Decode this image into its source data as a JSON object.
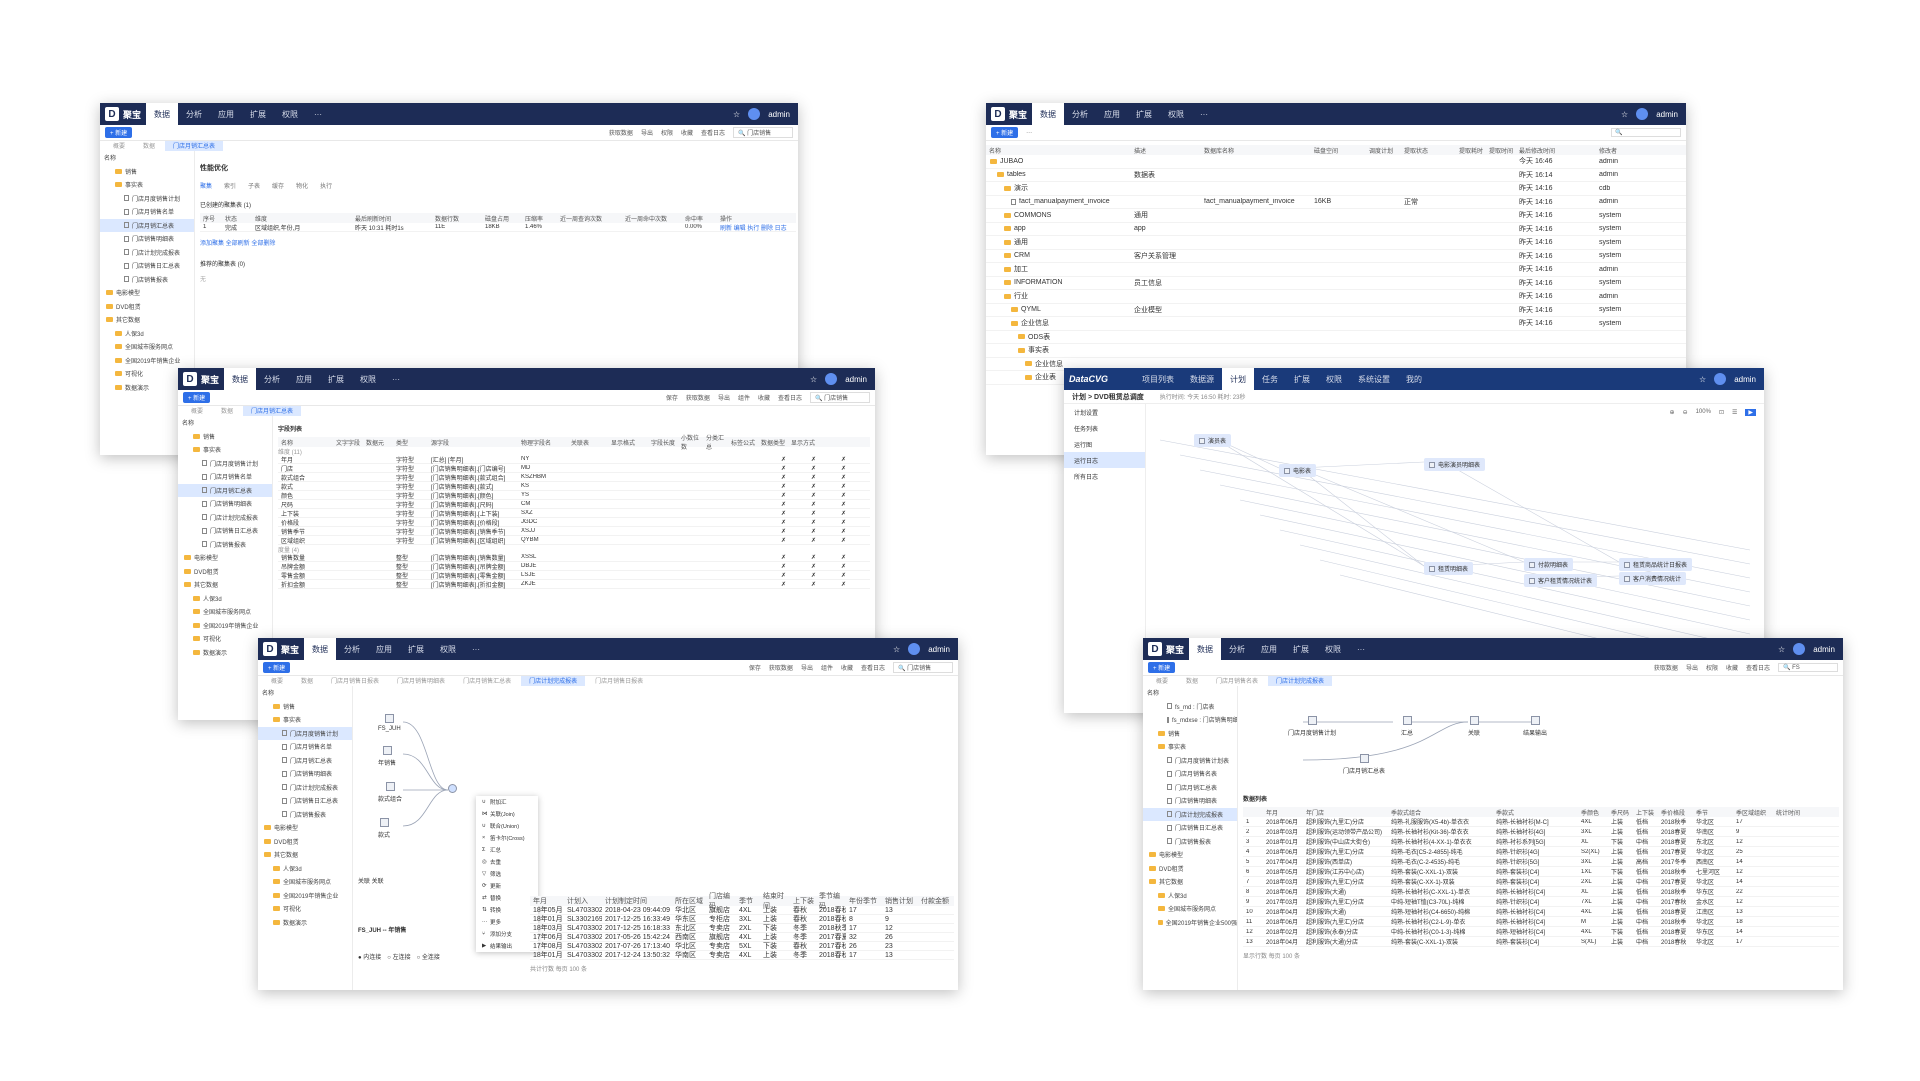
{
  "topnav": {
    "app_name": "聚宝",
    "items": [
      "数据",
      "分析",
      "应用",
      "扩展",
      "权限"
    ],
    "more": "···",
    "user": "admin"
  },
  "toolbar": {
    "new_label": "+ 新建",
    "w1": [
      "获取数据",
      "导出",
      "权限",
      "收藏",
      "查看日志"
    ],
    "w3": [
      "保存",
      "获取数据",
      "导出",
      "组件",
      "收藏",
      "查看日志"
    ],
    "search_placeholder": "门店销售",
    "w4_search": "FS"
  },
  "tabs": {
    "w1": [
      "概要",
      "数据",
      "门店月销汇总表"
    ],
    "w3": [
      "概要",
      "数据",
      "门店月销汇总表"
    ],
    "w5": [
      "概要",
      "数据",
      "门店月销售日报表",
      "门店月销售明细表",
      "门店月销售汇总表",
      "门店计划完成报表",
      "门店月销售日报表"
    ],
    "w6": [
      "概要",
      "数据",
      "门店月销售名表",
      "门店计划完成报表"
    ]
  },
  "sidebar": {
    "title": "名称",
    "w1": [
      "销售",
      "事实表",
      "门店月度销售计划",
      "门店月销售名单",
      "门店月销汇总表",
      "门店销售明细表",
      "门店计划完成报表",
      "门店销售日汇总表",
      "门店销售报表",
      "电影模型",
      "DVD租赁",
      "其它数据",
      "人保3d",
      "全国城市服务网点",
      "全国2019年销售企业",
      "可视化",
      "数据演示"
    ],
    "w3": [
      "销售",
      "事实表",
      "门店月度销售计划",
      "门店月销售名单",
      "门店月销汇总表",
      "门店销售明细表",
      "门店计划完成报表",
      "门店销售日汇总表",
      "门店销售报表",
      "电影模型",
      "DVD租赁",
      "其它数据",
      "人保3d",
      "全国城市服务网点",
      "全国2019年销售企业",
      "可视化",
      "数据演示"
    ],
    "w5": [
      "销售",
      "事实表",
      "门店月度销售计划",
      "门店月销售名单",
      "门店月销汇总表",
      "门店销售明细表",
      "门店计划完成报表",
      "门店销售日汇总表",
      "门店销售报表",
      "电影模型",
      "DVD租赁",
      "其它数据",
      "人保3d",
      "全国城市服务网点",
      "全国2019年销售企业",
      "可视化",
      "数据演示"
    ],
    "w6": [
      "fs_md : 门店表",
      "fs_mdxse : 门店销售明细",
      "销售",
      "事实表",
      "门店月度销售计划表",
      "门店月销售名表",
      "门店月销汇总表",
      "门店销售明细表",
      "门店计划完成报表",
      "门店销售日汇总表",
      "门店销售报表",
      "电影模型",
      "DVD租赁",
      "其它数据",
      "人保3d",
      "全国城市服务网点",
      "全国2019年销售企业500强"
    ]
  },
  "w1": {
    "section": "性能优化",
    "subtabs": [
      "聚集",
      "索引",
      "子表",
      "缓存",
      "物化",
      "执行"
    ],
    "list_title": "已创建的聚集表 (1)",
    "headers": [
      "序号",
      "状态",
      "维度",
      "最后刷新时间",
      "数据行数",
      "磁盘占用",
      "压缩率",
      "近一周查询次数",
      "近一周命中次数",
      "命中率",
      "操作"
    ],
    "row": [
      "1",
      "完成",
      "区域组织,年份,月",
      "昨天 10:31 耗时1s",
      "11E",
      "18KB",
      "1.46%",
      "",
      "",
      "0.00%",
      "刷新 编辑 执行 删除 日志"
    ],
    "links": "添加聚集  全部刷新  全部删除",
    "rec": "推荐的聚集表 (0)",
    "empty": "无"
  },
  "w2": {
    "headers": [
      "名称",
      "描述",
      "数据库名称",
      "磁盘空间",
      "",
      "调度计划",
      "提取状态",
      "提取耗时",
      "提取时间",
      "最后修改时间",
      "修改者"
    ],
    "rows": [
      {
        "name": "JUBAO",
        "desc": "",
        "db": "",
        "time": "今天 16:46",
        "user": "admin"
      },
      {
        "name": "tables",
        "desc": "数据表",
        "db": "",
        "time": "昨天 16:14",
        "user": "admin"
      },
      {
        "name": "演示",
        "desc": "",
        "db": "",
        "time": "昨天 14:16",
        "user": "cdb"
      },
      {
        "name": "fact_manualpayment_invoice",
        "desc": "",
        "db": "fact_manualpayment_invoice",
        "time": "昨天 14:16",
        "user": "admin"
      },
      {
        "name": "COMMONS",
        "desc": "通用",
        "db": "",
        "time": "昨天 14:16",
        "user": "system"
      },
      {
        "name": "app",
        "desc": "app",
        "db": "",
        "time": "昨天 14:16",
        "user": "system"
      },
      {
        "name": "通用",
        "desc": "",
        "db": "",
        "time": "昨天 14:16",
        "user": "system"
      },
      {
        "name": "CRM",
        "desc": "客户关系管理",
        "db": "",
        "time": "昨天 14:16",
        "user": "system"
      },
      {
        "name": "加工",
        "desc": "",
        "db": "",
        "time": "昨天 14:16",
        "user": "admin"
      },
      {
        "name": "INFORMATION",
        "desc": "员工信息",
        "db": "",
        "time": "昨天 14:16",
        "user": "system"
      },
      {
        "name": "行业",
        "desc": "",
        "db": "",
        "time": "昨天 14:16",
        "user": "admin"
      },
      {
        "name": "QYML",
        "desc": "企业模型",
        "db": "",
        "time": "昨天 14:16",
        "user": "system"
      },
      {
        "name": "企业信息",
        "desc": "",
        "db": "",
        "time": "昨天 14:16",
        "user": "system"
      },
      {
        "name": "ODS表",
        "desc": "",
        "db": "",
        "time": "",
        "user": ""
      },
      {
        "name": "事实表",
        "desc": "",
        "db": "",
        "time": "",
        "user": ""
      },
      {
        "name": "企业信息",
        "desc": "",
        "db": "",
        "time": "",
        "user": ""
      },
      {
        "name": "企业表",
        "desc": "",
        "db": "",
        "time": "",
        "user": ""
      }
    ],
    "disk": "16KB",
    "status": "正常"
  },
  "w3": {
    "title": "字段列表",
    "headers": [
      "名称",
      "文字字段",
      "数据元",
      "类型",
      "源字段",
      "物理字段名",
      "关联表",
      "显示格式",
      "字段长度",
      "小数位数",
      "分类汇总",
      "标签公式",
      "数据类型",
      "显示方式"
    ],
    "group1": "维度 (11)",
    "rows": [
      [
        "年月",
        "字符型",
        "[汇总] [年月]",
        "NY"
      ],
      [
        "门店",
        "字符型",
        "[门店销售明细表].[门店编号]",
        "MD"
      ],
      [
        "款式组合",
        "字符型",
        "[门店销售明细表].[款式组合]",
        "KSZHBM"
      ],
      [
        "款式",
        "字符型",
        "[门店销售明细表].[款式]",
        "KS"
      ],
      [
        "颜色",
        "字符型",
        "[门店销售明细表].[颜色]",
        "YS"
      ],
      [
        "尺码",
        "字符型",
        "[门店销售明细表].[尺码]",
        "CM"
      ],
      [
        "上下装",
        "字符型",
        "[门店销售明细表].[上下装]",
        "SXZ"
      ],
      [
        "价格段",
        "字符型",
        "[门店销售明细表].[价格段]",
        "JGDC"
      ],
      [
        "销售季节",
        "字符型",
        "[门店销售明细表].[销售季节]",
        "XSJJ"
      ],
      [
        "区域组织",
        "字符型",
        "[门店销售明细表].[区域组织]",
        "QYBM"
      ]
    ],
    "group2": "度量 (4)",
    "rows2": [
      [
        "销售数量",
        "整型",
        "[门店销售明细表].[销售数量]",
        "XSSL"
      ],
      [
        "吊牌金额",
        "整型",
        "[门店销售明细表].[吊牌金额]",
        "DBJE"
      ],
      [
        "零售金额",
        "整型",
        "[门店销售明细表].[零售金额]",
        "LSJE"
      ],
      [
        "折扣金额",
        "整型",
        "[门店销售明细表].[折扣金额]",
        "ZKJE"
      ]
    ]
  },
  "w4": {
    "brand": "DataCVG",
    "nav": [
      "项目列表",
      "数据源",
      "计划",
      "任务",
      "扩展",
      "权限",
      "系统设置",
      "我的"
    ],
    "crumb": "计划 > DVD租赁总调度",
    "info": "执行时间: 今天 16:50  耗时: 23秒",
    "menu": [
      "计划设置",
      "任务列表",
      "运行图",
      "运行日志",
      "所有日志"
    ],
    "zoom": "100%",
    "nodes": [
      "演员表",
      "电影表",
      "电影演员明细表",
      "租赁明细表",
      "付款明细表",
      "客户租赁情况统计表",
      "租赁商品统计日报表",
      "客户消费情况统计"
    ]
  },
  "w5": {
    "nodes": [
      "FS_JUH",
      "年销售",
      "款式组合",
      "款式"
    ],
    "menu": [
      "附加汇",
      "关联(Join)",
      "联合(Union)",
      "笛卡尔(Cross)",
      "汇总",
      "去重",
      "筛选",
      "更新",
      "替换",
      "转换",
      "更多",
      "添加分支",
      "结果输出"
    ],
    "panel_title": "FS_JUH -- 年销售",
    "relation": "关联  关联",
    "mode": [
      "内连接",
      "左连接",
      "全连接"
    ],
    "table_headers": [
      "年月",
      "计划入",
      "计划制定时间",
      "所在区域",
      "门店编码",
      "季节",
      "结束时间",
      "上下装",
      "季节编码",
      "年份季节",
      "销售计划",
      "付款金额"
    ],
    "rows": [
      [
        "18年05月",
        "SL4703302",
        "2018-04-23 09:44:09",
        "华北区",
        "旗舰店",
        "4XL",
        "上装",
        "春秋",
        "2018春秋",
        "17",
        "13"
      ],
      [
        "18年01月",
        "SL3302169",
        "2017-12-25 16:33:49",
        "华东区",
        "专柜店",
        "3XL",
        "上装",
        "春秋",
        "2018春秋",
        "8",
        "9"
      ],
      [
        "18年03月",
        "SL4703302",
        "2017-12-25 16:18:33",
        "东北区",
        "专卖店",
        "2XL",
        "下装",
        "冬季",
        "2018秋季",
        "17",
        "12"
      ],
      [
        "17年06月",
        "SL4703302",
        "2017-05-26 15:42:24",
        "西南区",
        "旗舰店",
        "4XL",
        "上装",
        "冬季",
        "2017春夏",
        "32",
        "26"
      ],
      [
        "17年08月",
        "SL4703302",
        "2017-07-26 17:13:40",
        "华北区",
        "专卖店",
        "5XL",
        "下装",
        "春秋",
        "2017春秋",
        "26",
        "23"
      ],
      [
        "18年01月",
        "SL4703302",
        "2017-12-24 13:50:32",
        "华南区",
        "专卖店",
        "4XL",
        "上装",
        "冬季",
        "2018春秋",
        "17",
        "13"
      ]
    ],
    "footer": "共计行数  每页 100 条"
  },
  "w6": {
    "nodes": [
      "门店月度销售计划",
      "汇总",
      "关联",
      "结果输出",
      "门店月销汇总表"
    ],
    "title": "数据列表",
    "headers": [
      "年月",
      "年门店",
      "季款式组合",
      "季款式",
      "季颜色",
      "季尺码",
      "上下装",
      "季价格段",
      "季节",
      "季区域组织",
      "统计时间"
    ],
    "rows": [
      [
        "1",
        "2018年06月",
        "超利服饰(九里汇)分店",
        "纯熟-礼服服饰(X5-4b)-单衣衣",
        "纯熟-长袖衬衫[M-C]",
        "4XL",
        "上装",
        "低档",
        "2018秋季",
        "华北区",
        "17"
      ],
      [
        "2",
        "2018年03月",
        "超利服饰(运动领带产品公司)",
        "纯熟-长袖衬衫(Kit-36)-单衣衣",
        "纯熟-长袖衬衫[4G]",
        "3XL",
        "上装",
        "低档",
        "2018春夏",
        "华南区",
        "9"
      ],
      [
        "3",
        "2018年01月",
        "超利服饰(中山店大街仓)",
        "纯熟-长袖衬衫(4-XX-1)-单衣衣",
        "纯熟-衬衫系列[5G]",
        "XL",
        "下装",
        "中档",
        "2018春夏",
        "东北区",
        "12"
      ],
      [
        "4",
        "2018年06月",
        "超利服饰(九里汇)分店",
        "纯熟-毛衣[C5-2-4855]-纯毛",
        "纯熟-针织衫[4G]",
        "S2(XL)",
        "上装",
        "低档",
        "2017春夏",
        "华北区",
        "25"
      ],
      [
        "5",
        "2017年04月",
        "超利服饰(西单店)",
        "纯熟-毛衣(C-2-4535)-纯毛",
        "纯熟-针织衫[5G]",
        "3XL",
        "上装",
        "高档",
        "2017冬季",
        "西南区",
        "14"
      ],
      [
        "6",
        "2018年05月",
        "超利服饰(江苏中心店)",
        "纯熟-套装(C-XXL-1)-双装",
        "纯熟-套装衫[C4]",
        "1XL",
        "下装",
        "低档",
        "2018秋季",
        "七里河区",
        "12"
      ],
      [
        "7",
        "2018年03月",
        "超利服饰(九里汇)分店",
        "纯熟-套装(C-XX-1)-双装",
        "纯熟-套装衫[C4]",
        "2XL",
        "上装",
        "中档",
        "2017春夏",
        "华北区",
        "14"
      ],
      [
        "8",
        "2018年06月",
        "超利服饰(大通)",
        "纯熟-长袖衬衫(C-XXL-1)-单衣",
        "纯熟-长袖衬衫[C4]",
        "XL",
        "上装",
        "低档",
        "2018秋季",
        "华东区",
        "22"
      ],
      [
        "9",
        "2017年03月",
        "超利服饰(九里汇)分店",
        "中纯-短袖T恤(C3-70L)-纯棉",
        "纯熟-针织衫[C4]",
        "7XL",
        "上装",
        "中档",
        "2017春秋",
        "金水区",
        "12"
      ],
      [
        "10",
        "2018年04月",
        "超利服饰(大通)",
        "纯熟-短袖衬衫(C4-6650)-纯棉",
        "纯熟-长袖衬衫[C4]",
        "4XL",
        "上装",
        "低档",
        "2018春夏",
        "江南区",
        "13"
      ],
      [
        "11",
        "2018年06月",
        "超利服饰(九里汇)分店",
        "纯熟-长袖衬衫(C2-L-9)-单衣",
        "纯熟-长袖衬衫[C4]",
        "M",
        "上装",
        "中档",
        "2018秋季",
        "华北区",
        "18"
      ],
      [
        "12",
        "2018年02月",
        "超利服饰(永泰)分店",
        "中纯-长袖衬衫(C0-1-3)-纯棉",
        "纯熟-短袖衬衫[C4]",
        "4XL",
        "下装",
        "低档",
        "2018春夏",
        "华东区",
        "14"
      ],
      [
        "13",
        "2018年04月",
        "超利服饰(大通)分店",
        "纯熟-套装(C-XXL-1)-双装",
        "纯熟-套装衫[C4]",
        "S(XL)",
        "上装",
        "中档",
        "2018春秋",
        "华北区",
        "17"
      ]
    ],
    "footer": "显示行数  每页 100 条"
  }
}
